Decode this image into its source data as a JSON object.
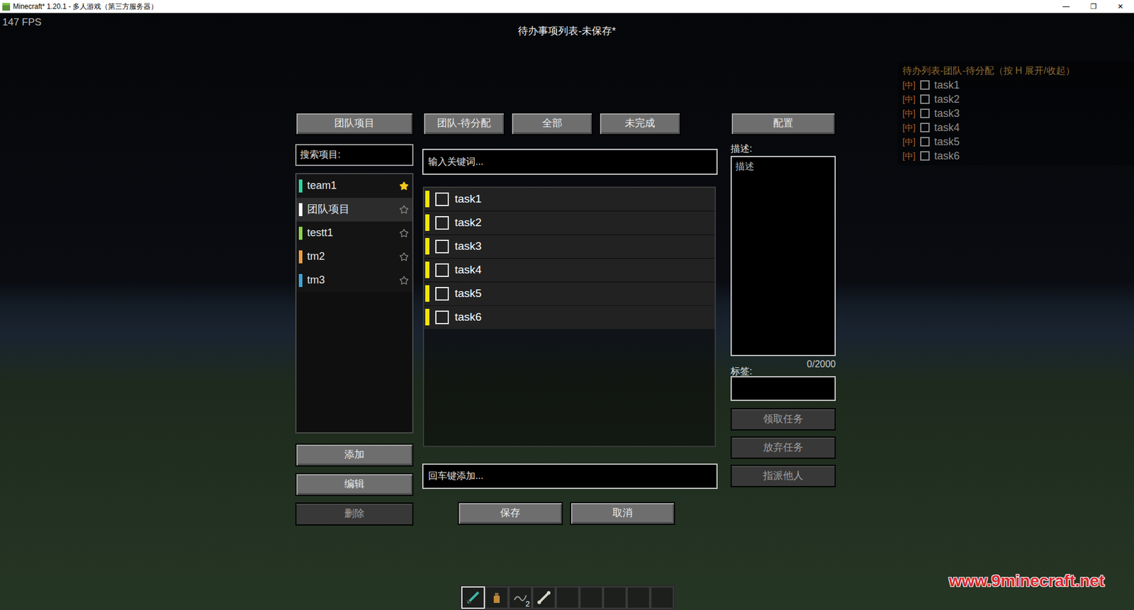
{
  "window": {
    "title": "Minecraft* 1.20.1 - 多人游戏（第三方服务器）",
    "controls": [
      "—",
      "❐",
      "✕"
    ]
  },
  "fps": "147 FPS",
  "screen_title": "待办事项列表-未保存*",
  "projects_button": "团队项目",
  "tabs": [
    {
      "label": "团队-待分配"
    },
    {
      "label": "全部"
    },
    {
      "label": "未完成"
    }
  ],
  "config_button": "配置",
  "project_search": {
    "placeholder": "搜索项目:"
  },
  "projects": [
    {
      "name": "team1",
      "color": "#2fd6a3",
      "favorite": true,
      "selected": false
    },
    {
      "name": "团队项目",
      "color": "#ffffff",
      "favorite": false,
      "selected": true
    },
    {
      "name": "testt1",
      "color": "#8fd64a",
      "favorite": false,
      "selected": false
    },
    {
      "name": "tm2",
      "color": "#f0a040",
      "favorite": false,
      "selected": false
    },
    {
      "name": "tm3",
      "color": "#3ea6d8",
      "favorite": false,
      "selected": false
    }
  ],
  "project_buttons": [
    {
      "label": "添加",
      "disabled": false
    },
    {
      "label": "编辑",
      "disabled": false
    },
    {
      "label": "删除",
      "disabled": true
    }
  ],
  "task_search": {
    "placeholder": "输入关键词..."
  },
  "tasks": [
    {
      "name": "task1",
      "checked": false,
      "color": "#f2e600"
    },
    {
      "name": "task2",
      "checked": false,
      "color": "#f2e600"
    },
    {
      "name": "task3",
      "checked": false,
      "color": "#f2e600"
    },
    {
      "name": "task4",
      "checked": false,
      "color": "#f2e600"
    },
    {
      "name": "task5",
      "checked": false,
      "color": "#f2e600"
    },
    {
      "name": "task6",
      "checked": false,
      "color": "#f2e600"
    }
  ],
  "new_task": {
    "placeholder": "回车键添加..."
  },
  "actions": [
    {
      "label": "保存"
    },
    {
      "label": "取消"
    }
  ],
  "details": {
    "description_label": "描述:",
    "description_placeholder": "描述",
    "tags_label": "标签:",
    "counter": "0/2000",
    "buttons": [
      {
        "label": "领取任务",
        "disabled": true
      },
      {
        "label": "放弃任务",
        "disabled": true
      },
      {
        "label": "指派他人",
        "disabled": true
      }
    ]
  },
  "hud": {
    "title": "待办列表-团队-待分配（按 H 展开/收起）",
    "items": [
      {
        "priority": "[中]",
        "name": "task1",
        "checked": false
      },
      {
        "priority": "[中]",
        "name": "task2",
        "checked": false
      },
      {
        "priority": "[中]",
        "name": "task3",
        "checked": false
      },
      {
        "priority": "[中]",
        "name": "task4",
        "checked": false
      },
      {
        "priority": "[中]",
        "name": "task5",
        "checked": false
      },
      {
        "priority": "[中]",
        "name": "task6",
        "checked": false
      }
    ]
  },
  "hotbar": {
    "slots": [
      {
        "kind": "sword",
        "count": "",
        "selected": true
      },
      {
        "kind": "bottle",
        "count": "",
        "selected": false
      },
      {
        "kind": "string",
        "count": "2",
        "selected": false
      },
      {
        "kind": "bone",
        "count": "",
        "selected": false
      },
      {
        "kind": "empty",
        "count": "",
        "selected": false
      },
      {
        "kind": "empty",
        "count": "",
        "selected": false
      },
      {
        "kind": "empty",
        "count": "",
        "selected": false
      },
      {
        "kind": "empty",
        "count": "",
        "selected": false
      },
      {
        "kind": "empty",
        "count": "",
        "selected": false
      }
    ]
  },
  "watermark": "www.9minecraft.net"
}
